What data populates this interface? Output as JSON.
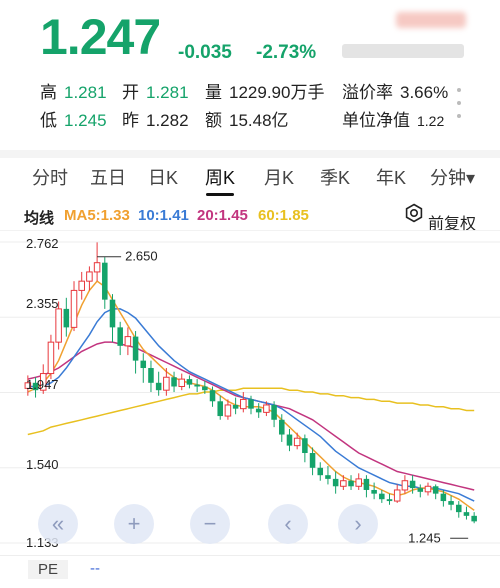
{
  "quote": {
    "price": "1.247",
    "change": "-0.035",
    "change_pct": "-2.73%",
    "high_label": "高",
    "high_value": "1.281",
    "open_label": "开",
    "open_value": "1.281",
    "volume_label": "量",
    "volume_value": "1229.90万手",
    "premium_label": "溢价率",
    "premium_value": "3.66%",
    "low_label": "低",
    "low_value": "1.245",
    "prev_label": "昨",
    "prev_value": "1.282",
    "amount_label": "额",
    "amount_value": "15.48亿",
    "nav_label": "单位净值",
    "nav_value": "1.22"
  },
  "tabs": [
    {
      "label": "分时"
    },
    {
      "label": "五日"
    },
    {
      "label": "日K"
    },
    {
      "label": "周K"
    },
    {
      "label": "月K"
    },
    {
      "label": "季K"
    },
    {
      "label": "年K"
    },
    {
      "label": "分钟▾"
    }
  ],
  "active_tab": "周K",
  "indicators": {
    "ma_label": "均线",
    "ma5": "MA5:1.33",
    "ma10": "10:1.41",
    "ma20": "20:1.45",
    "ma60": "60:1.85",
    "adjust_label": "前复权"
  },
  "colors": {
    "up": "#e8383d",
    "down": "#15a36a",
    "ma5": "#f0a030",
    "ma10": "#3a7bd5",
    "ma20": "#c2357f",
    "ma60": "#e8c020"
  },
  "chart_data": {
    "type": "candlestick",
    "y_labels": [
      "2.762",
      "2.355",
      "1.947",
      "1.540",
      "1.133"
    ],
    "ylim": [
      1.133,
      2.762
    ],
    "annotations": [
      {
        "label": "2.650",
        "value": 2.65
      },
      {
        "label": "1.245",
        "value": 1.245
      }
    ],
    "candles": [
      [
        1.97,
        2.0,
        1.93,
        2.04
      ],
      [
        2.0,
        1.96,
        1.92,
        2.03
      ],
      [
        1.96,
        2.05,
        1.94,
        2.1
      ],
      [
        2.05,
        2.22,
        2.02,
        2.26
      ],
      [
        2.22,
        2.4,
        2.18,
        2.44
      ],
      [
        2.4,
        2.3,
        2.25,
        2.46
      ],
      [
        2.3,
        2.5,
        2.28,
        2.55
      ],
      [
        2.5,
        2.55,
        2.45,
        2.6
      ],
      [
        2.55,
        2.6,
        2.5,
        2.63
      ],
      [
        2.6,
        2.65,
        2.55,
        2.76
      ],
      [
        2.65,
        2.45,
        2.4,
        2.68
      ],
      [
        2.45,
        2.3,
        2.22,
        2.48
      ],
      [
        2.3,
        2.2,
        2.15,
        2.33
      ],
      [
        2.2,
        2.25,
        2.15,
        2.3
      ],
      [
        2.25,
        2.12,
        2.05,
        2.28
      ],
      [
        2.12,
        2.08,
        2.0,
        2.16
      ],
      [
        2.08,
        2.0,
        1.95,
        2.12
      ],
      [
        2.0,
        1.96,
        1.93,
        2.06
      ],
      [
        1.96,
        2.03,
        1.93,
        2.08
      ],
      [
        2.03,
        1.98,
        1.95,
        2.06
      ],
      [
        1.98,
        2.02,
        1.96,
        2.05
      ],
      [
        2.02,
        1.99,
        1.97,
        2.04
      ],
      [
        1.99,
        1.98,
        1.95,
        2.02
      ],
      [
        1.98,
        1.96,
        1.94,
        2.01
      ],
      [
        1.96,
        1.9,
        1.87,
        1.98
      ],
      [
        1.9,
        1.82,
        1.8,
        1.93
      ],
      [
        1.82,
        1.88,
        1.8,
        1.91
      ],
      [
        1.88,
        1.86,
        1.83,
        1.92
      ],
      [
        1.86,
        1.91,
        1.84,
        1.95
      ],
      [
        1.91,
        1.86,
        1.83,
        1.93
      ],
      [
        1.86,
        1.84,
        1.81,
        1.89
      ],
      [
        1.84,
        1.88,
        1.82,
        1.9
      ],
      [
        1.88,
        1.8,
        1.76,
        1.9
      ],
      [
        1.8,
        1.72,
        1.68,
        1.83
      ],
      [
        1.72,
        1.66,
        1.63,
        1.75
      ],
      [
        1.66,
        1.7,
        1.64,
        1.73
      ],
      [
        1.7,
        1.62,
        1.57,
        1.72
      ],
      [
        1.62,
        1.54,
        1.5,
        1.65
      ],
      [
        1.54,
        1.5,
        1.47,
        1.57
      ],
      [
        1.5,
        1.48,
        1.45,
        1.55
      ],
      [
        1.48,
        1.44,
        1.4,
        1.52
      ],
      [
        1.44,
        1.47,
        1.42,
        1.5
      ],
      [
        1.47,
        1.44,
        1.42,
        1.5
      ],
      [
        1.44,
        1.48,
        1.42,
        1.51
      ],
      [
        1.48,
        1.42,
        1.38,
        1.5
      ],
      [
        1.42,
        1.4,
        1.37,
        1.46
      ],
      [
        1.4,
        1.37,
        1.35,
        1.42
      ],
      [
        1.37,
        1.36,
        1.34,
        1.4
      ],
      [
        1.36,
        1.42,
        1.35,
        1.45
      ],
      [
        1.42,
        1.47,
        1.4,
        1.5
      ],
      [
        1.47,
        1.43,
        1.4,
        1.5
      ],
      [
        1.43,
        1.41,
        1.38,
        1.45
      ],
      [
        1.41,
        1.44,
        1.39,
        1.46
      ],
      [
        1.44,
        1.4,
        1.37,
        1.45
      ],
      [
        1.4,
        1.36,
        1.33,
        1.42
      ],
      [
        1.36,
        1.34,
        1.31,
        1.39
      ],
      [
        1.34,
        1.3,
        1.27,
        1.36
      ],
      [
        1.3,
        1.28,
        1.26,
        1.33
      ],
      [
        1.28,
        1.25,
        1.24,
        1.3
      ]
    ],
    "ma5": [
      1.95,
      1.97,
      2.0,
      2.05,
      2.12,
      2.22,
      2.32,
      2.42,
      2.5,
      2.55,
      2.52,
      2.45,
      2.38,
      2.31,
      2.24,
      2.18,
      2.14,
      2.1,
      2.06,
      2.03,
      2.01,
      2.0,
      1.99,
      1.98,
      1.96,
      1.93,
      1.9,
      1.88,
      1.87,
      1.87,
      1.87,
      1.86,
      1.84,
      1.8,
      1.76,
      1.72,
      1.68,
      1.64,
      1.6,
      1.56,
      1.52,
      1.49,
      1.47,
      1.46,
      1.45,
      1.44,
      1.42,
      1.4,
      1.39,
      1.4,
      1.42,
      1.43,
      1.43,
      1.42,
      1.41,
      1.39,
      1.37,
      1.34,
      1.31
    ],
    "ma10": [
      1.98,
      1.98,
      1.98,
      2.0,
      2.03,
      2.08,
      2.14,
      2.2,
      2.26,
      2.33,
      2.38,
      2.4,
      2.4,
      2.38,
      2.35,
      2.3,
      2.25,
      2.2,
      2.16,
      2.12,
      2.09,
      2.06,
      2.04,
      2.02,
      2.0,
      1.98,
      1.96,
      1.94,
      1.92,
      1.91,
      1.9,
      1.89,
      1.88,
      1.86,
      1.83,
      1.8,
      1.77,
      1.74,
      1.71,
      1.67,
      1.63,
      1.6,
      1.57,
      1.54,
      1.52,
      1.5,
      1.48,
      1.46,
      1.45,
      1.44,
      1.44,
      1.43,
      1.43,
      1.43,
      1.42,
      1.41,
      1.4,
      1.38,
      1.36
    ],
    "ma20": [
      2.02,
      2.03,
      2.04,
      2.06,
      2.08,
      2.11,
      2.14,
      2.17,
      2.19,
      2.21,
      2.22,
      2.22,
      2.21,
      2.2,
      2.19,
      2.17,
      2.15,
      2.13,
      2.11,
      2.09,
      2.07,
      2.05,
      2.03,
      2.01,
      1.99,
      1.97,
      1.95,
      1.93,
      1.92,
      1.91,
      1.9,
      1.89,
      1.88,
      1.87,
      1.86,
      1.84,
      1.82,
      1.8,
      1.77,
      1.74,
      1.71,
      1.68,
      1.65,
      1.62,
      1.6,
      1.58,
      1.56,
      1.54,
      1.52,
      1.51,
      1.5,
      1.49,
      1.48,
      1.47,
      1.46,
      1.45,
      1.44,
      1.43,
      1.42
    ],
    "ma60": [
      1.72,
      1.73,
      1.74,
      1.76,
      1.77,
      1.78,
      1.79,
      1.8,
      1.81,
      1.82,
      1.83,
      1.84,
      1.85,
      1.86,
      1.87,
      1.88,
      1.89,
      1.9,
      1.91,
      1.92,
      1.93,
      1.94,
      1.94,
      1.95,
      1.95,
      1.96,
      1.96,
      1.96,
      1.97,
      1.97,
      1.97,
      1.97,
      1.97,
      1.97,
      1.96,
      1.96,
      1.95,
      1.95,
      1.94,
      1.94,
      1.93,
      1.93,
      1.92,
      1.92,
      1.91,
      1.91,
      1.9,
      1.9,
      1.89,
      1.89,
      1.89,
      1.88,
      1.88,
      1.87,
      1.87,
      1.86,
      1.86,
      1.85,
      1.85
    ]
  },
  "controls": [
    {
      "icon": "double-chevron-left-icon",
      "glyph": "«"
    },
    {
      "icon": "plus-icon",
      "glyph": "+"
    },
    {
      "icon": "minus-icon",
      "glyph": "−"
    },
    {
      "icon": "chevron-left-icon",
      "glyph": "‹"
    },
    {
      "icon": "chevron-right-icon",
      "glyph": "›"
    }
  ],
  "bottom": {
    "pe_label": "PE",
    "pe_value": "--"
  }
}
